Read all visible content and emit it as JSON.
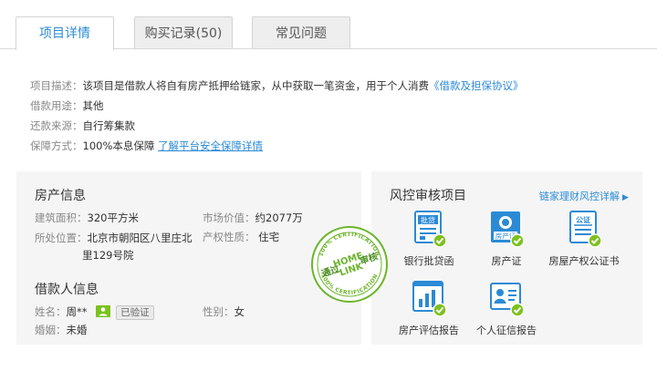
{
  "tabs": [
    {
      "label": "项目详情",
      "active": true
    },
    {
      "label": "购买记录(50)",
      "active": false
    },
    {
      "label": "常见问题",
      "active": false
    }
  ],
  "description": {
    "purpose_label": "项目描述：",
    "purpose_text": "该项目是借款人将自有房产抵押给链家，从中获取一笔资金，用于个人消费",
    "purpose_link": "《借款及担保协议》",
    "usage_label": "借款用途：",
    "usage_value": "其他",
    "repay_label": "还款来源：",
    "repay_value": "自行筹集款",
    "guarantee_label": "保障方式：",
    "guarantee_value": "100%本息保障",
    "guarantee_link": "了解平台安全保障详情"
  },
  "property": {
    "title": "房产信息",
    "area_label": "建筑面积：",
    "area_value": "320平方米",
    "price_label": "市场价值：",
    "price_value": "约2077万",
    "location_label": "所处位置：",
    "location_line1": "北京市朝阳区八里庄北",
    "location_line2": "里129号院",
    "nature_label": "产权性质：",
    "nature_value": "住宅"
  },
  "borrower": {
    "title": "借款人信息",
    "name_label": "姓名：",
    "name_value": "周**",
    "verified": "已验证",
    "gender_label": "性别：",
    "gender_value": "女",
    "marriage_label": "婚姻：",
    "marriage_value": "未婚"
  },
  "risk": {
    "title": "风控审核项目",
    "link": "链家理财风控详解",
    "items": [
      {
        "label": "银行批贷函",
        "icon": "bank-approval-icon",
        "icon_text": "批贷"
      },
      {
        "label": "房产证",
        "icon": "property-certificate-icon",
        "icon_text": "房产证"
      },
      {
        "label": "房屋产权公证书",
        "icon": "notarization-icon",
        "icon_text": "公证"
      },
      {
        "label": "房产评估报告",
        "icon": "appraisal-report-icon"
      },
      {
        "label": "个人征信报告",
        "icon": "credit-report-icon"
      }
    ]
  },
  "stamp": {
    "ring_top": "100% CERTIFICATION",
    "ring_bottom": "100% CERTIFICATION",
    "left_text": "通过",
    "right_text": "审核",
    "brand_line1": "HOME",
    "brand_line2": "LINK"
  },
  "colors": {
    "accent": "#2b8ad6",
    "check_green": "#7cc11e",
    "stamp_green": "#6bb52c",
    "panel_bg": "#f5f5f5"
  }
}
